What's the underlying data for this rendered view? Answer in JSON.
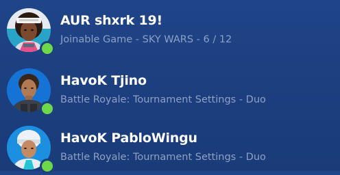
{
  "colors": {
    "background": "#1f4488",
    "name_text": "#ffffff",
    "status_text": "#8ea1c4",
    "online": "#6dd94a"
  },
  "friends": [
    {
      "name": "AUR shxrk 19!",
      "status": "Joinable Game - SKY WARS - 6 / 12",
      "avatar_icon": "avatar-headband-outfit",
      "presence": "online"
    },
    {
      "name": "HavoK Tjino",
      "status": "Battle Royale: Tournament Settings - Duo",
      "avatar_icon": "avatar-soldier-outfit",
      "presence": "online"
    },
    {
      "name": "HavoK PabloWingu",
      "status": "Battle Royale: Tournament Settings - Duo",
      "avatar_icon": "avatar-beanie-outfit",
      "presence": "online"
    }
  ]
}
